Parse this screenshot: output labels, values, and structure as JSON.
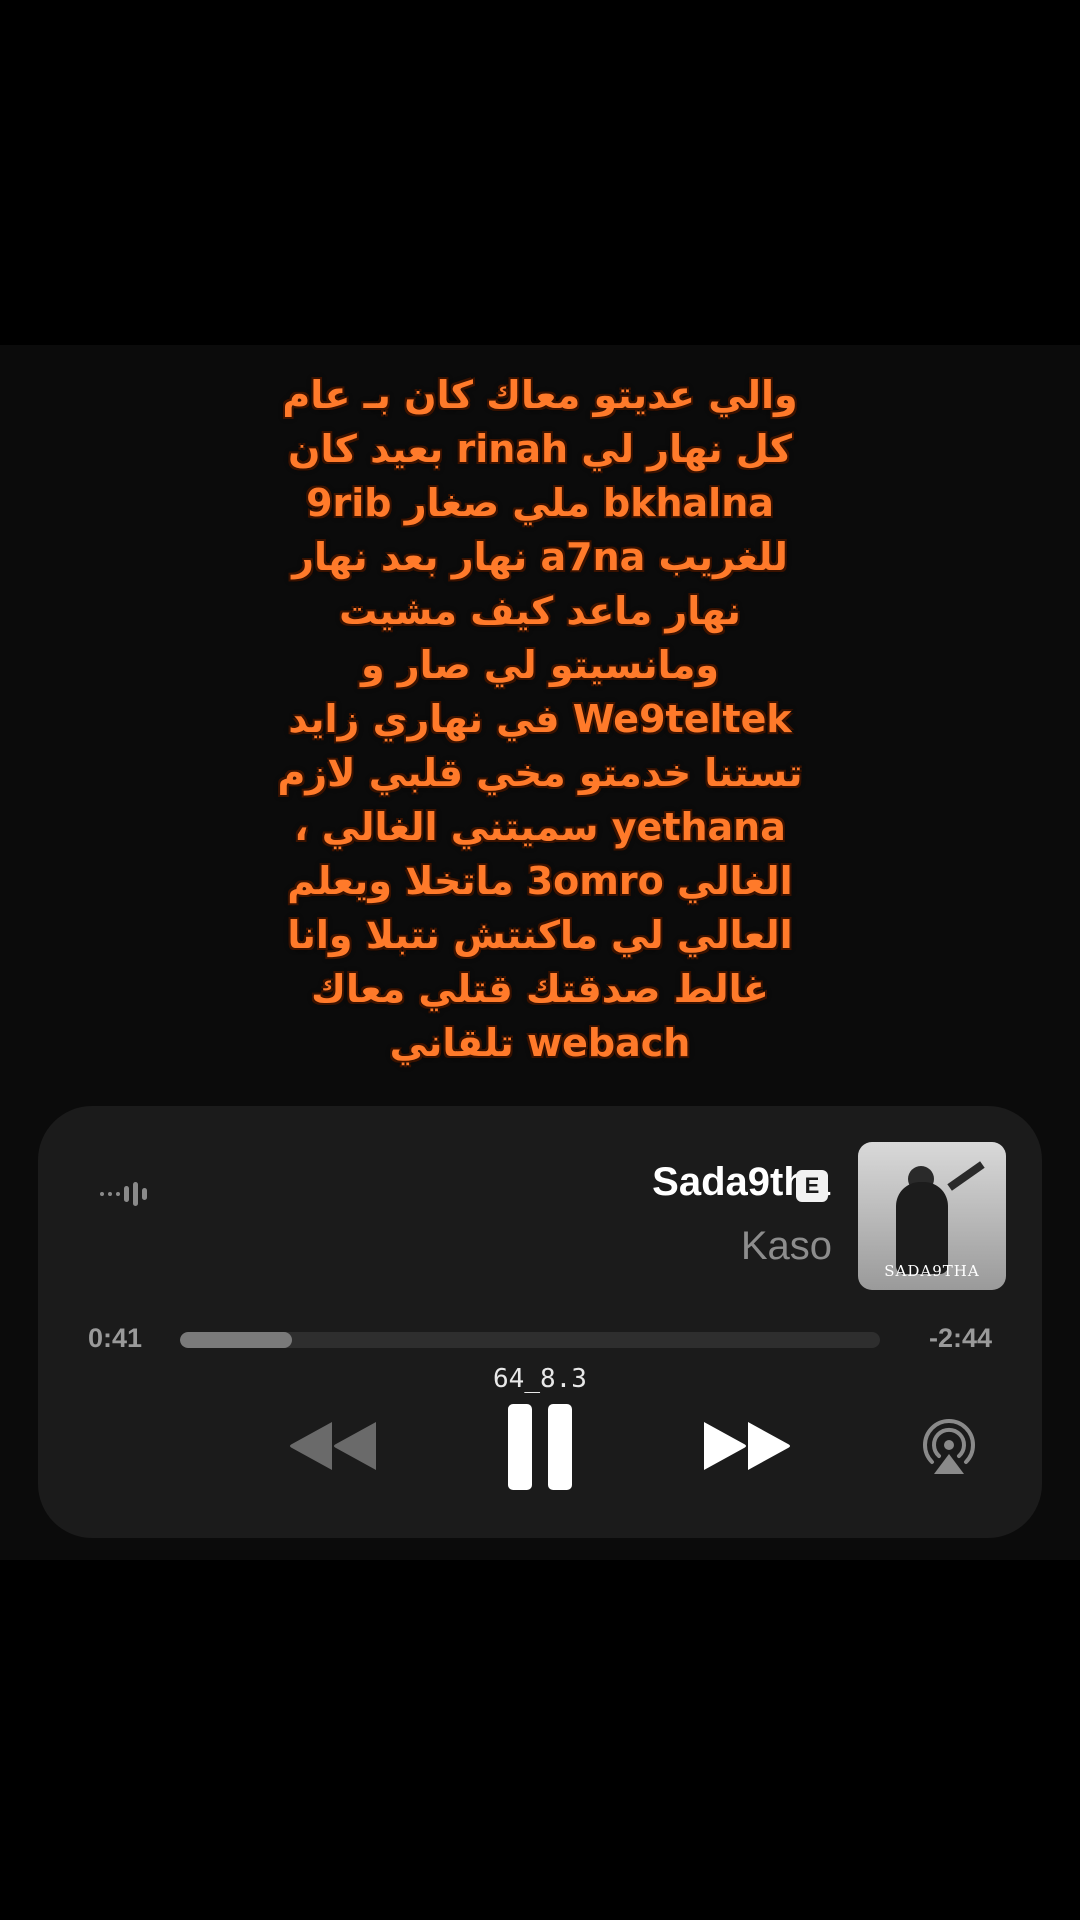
{
  "lyrics": {
    "lines": [
      "والي عديتو معاك كان بـ عام",
      "كل نهار لي rinah بعيد كان",
      "bkhalna ملي صغار 9rib",
      "للغريب a7na نهار بعد نهار",
      "نهار ماعد كيف مشيت",
      "ومانسيتو لي صار و",
      "We9teltek في نهاري زايد",
      "تستنا خدمتو مخي قلبي لازم",
      "yethana سميتني الغالي ،",
      "الغالي 3omro ماتخلا ويعلم",
      "العالي لي ماكنتش نتبلا وانا",
      "غالط صدقتك قتلي معاك",
      "webach تلقاني"
    ],
    "color": "#ff7a2a"
  },
  "player": {
    "song_title": "Sada9tha",
    "explicit_badge": "E",
    "artist": "Kaso",
    "album_art_text": "SADA9THA",
    "time_elapsed": "0:41",
    "time_remaining": "-2:44",
    "progress_fraction": 0.16,
    "overlay_tag": "64_8.3",
    "icons": {
      "wave": "audio-wave-icon",
      "rewind": "rewind-icon",
      "pause": "pause-icon",
      "forward": "fast-forward-icon",
      "airplay": "airplay-icon"
    }
  }
}
